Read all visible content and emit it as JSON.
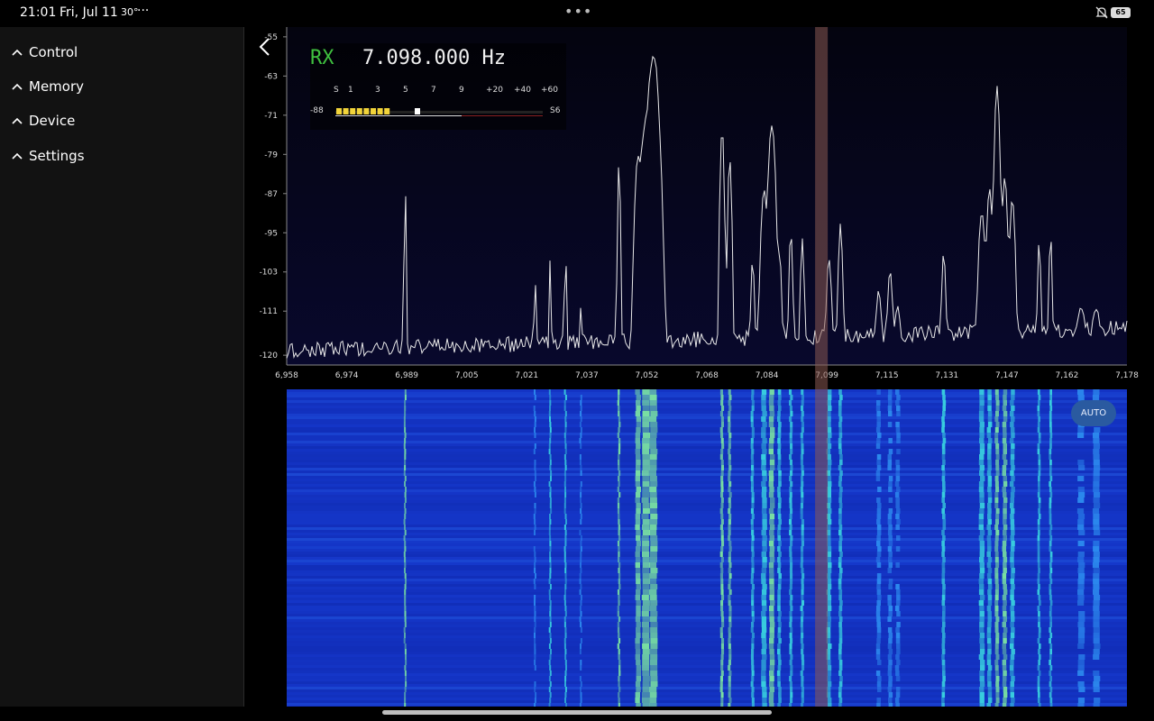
{
  "status_bar": {
    "time": "21:01",
    "date": "Fri, Jul 11",
    "temperature": "30°",
    "more": "···",
    "battery": "65"
  },
  "sidebar": {
    "items": [
      {
        "label": "Control"
      },
      {
        "label": "Memory"
      },
      {
        "label": "Device"
      },
      {
        "label": "Settings"
      }
    ]
  },
  "readout": {
    "mode": "RX",
    "frequency": "7.098.000 Hz",
    "s_scale": [
      "S",
      "1",
      "3",
      "5",
      "7",
      "9",
      "+20",
      "+40",
      "+60"
    ],
    "level_db": "-88",
    "s_reading": "S6",
    "level_fraction": 0.38
  },
  "spectrum": {
    "y_ticks": [
      "-55",
      "-63",
      "-71",
      "-79",
      "-87",
      "-95",
      "-103",
      "-111",
      "-120"
    ],
    "x_ticks": [
      "6,958",
      "6,974",
      "6,989",
      "7,005",
      "7,021",
      "7,037",
      "7,052",
      "7,068",
      "7,084",
      "7,099",
      "7,115",
      "7,131",
      "7,147",
      "7,162",
      "7,178"
    ],
    "tuned_khz": 7098,
    "span_khz": [
      6958,
      7178
    ],
    "db_range": [
      -122,
      -53
    ],
    "peaks": [
      {
        "f": 6989,
        "db": -82,
        "w": 0.15
      },
      {
        "f": 7023,
        "db": -103,
        "w": 0.2
      },
      {
        "f": 7027,
        "db": -100,
        "w": 0.2
      },
      {
        "f": 7031,
        "db": -98,
        "w": 0.2
      },
      {
        "f": 7035,
        "db": -110,
        "w": 0.2
      },
      {
        "f": 7045,
        "db": -80,
        "w": 0.25
      },
      {
        "f": 7050,
        "db": -79,
        "w": 0.6
      },
      {
        "f": 7052,
        "db": -72,
        "w": 0.9
      },
      {
        "f": 7054,
        "db": -58,
        "w": 0.9
      },
      {
        "f": 7072,
        "db": -73,
        "w": 0.35
      },
      {
        "f": 7074,
        "db": -79,
        "w": 0.35
      },
      {
        "f": 7080,
        "db": -100,
        "w": 0.35
      },
      {
        "f": 7083,
        "db": -86,
        "w": 0.6
      },
      {
        "f": 7085,
        "db": -72,
        "w": 0.6
      },
      {
        "f": 7087,
        "db": -98,
        "w": 0.4
      },
      {
        "f": 7090,
        "db": -94,
        "w": 0.35
      },
      {
        "f": 7093,
        "db": -96,
        "w": 0.35
      },
      {
        "f": 7100,
        "db": -100,
        "w": 0.5
      },
      {
        "f": 7103,
        "db": -93,
        "w": 0.4
      },
      {
        "f": 7113,
        "db": -106,
        "w": 0.5
      },
      {
        "f": 7116,
        "db": -102,
        "w": 0.5
      },
      {
        "f": 7118,
        "db": -110,
        "w": 0.5
      },
      {
        "f": 7130,
        "db": -99,
        "w": 0.4
      },
      {
        "f": 7140,
        "db": -90,
        "w": 0.6
      },
      {
        "f": 7142,
        "db": -85,
        "w": 0.5
      },
      {
        "f": 7144,
        "db": -65,
        "w": 0.45
      },
      {
        "f": 7146,
        "db": -83,
        "w": 0.5
      },
      {
        "f": 7148,
        "db": -88,
        "w": 0.5
      },
      {
        "f": 7155,
        "db": -96,
        "w": 0.3
      },
      {
        "f": 7158,
        "db": -95,
        "w": 0.3
      },
      {
        "f": 7166,
        "db": -111,
        "w": 0.8
      },
      {
        "f": 7170,
        "db": -112,
        "w": 0.8
      }
    ]
  },
  "waterfall": {
    "auto_label": "AUTO"
  },
  "colors": {
    "rx_green": "#3fbf3f",
    "meter_yellow": "#f2d43a",
    "tuned_marker": "#8a5a52",
    "spectrum_bg": "#06061a",
    "waterfall_base": "#1536c8"
  }
}
